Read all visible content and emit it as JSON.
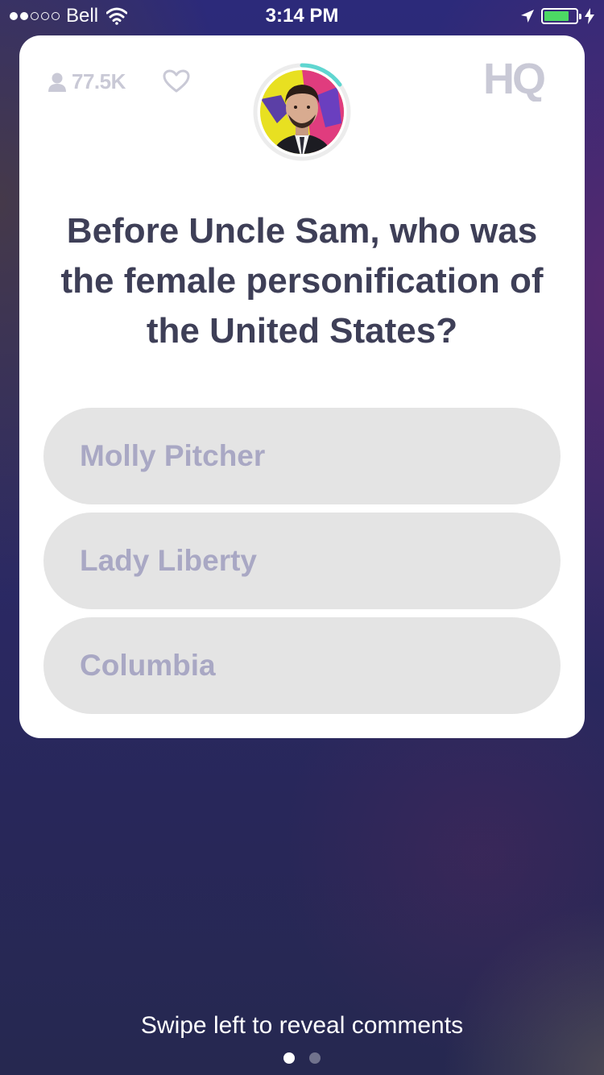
{
  "status_bar": {
    "carrier": "Bell",
    "time": "3:14 PM",
    "signal_bars_filled": 2,
    "signal_bars_total": 5,
    "battery_level": 0.8,
    "battery_color": "#4cd964"
  },
  "game": {
    "viewers": "77.5K",
    "logo": "HQ",
    "timer_progress": 0.15,
    "timer_color": "#5fd6d0",
    "question": "Before Uncle Sam, who was the female personification of the United States?",
    "answers": [
      {
        "label": "Molly Pitcher"
      },
      {
        "label": "Lady Liberty"
      },
      {
        "label": "Columbia"
      }
    ]
  },
  "footer": {
    "hint": "Swipe left to reveal comments",
    "pages": 2,
    "active_page": 0
  },
  "icons": {
    "viewers": "person-icon",
    "like": "heart-icon",
    "wifi": "wifi-icon",
    "location": "location-arrow-icon",
    "charging": "charging-bolt-icon"
  }
}
